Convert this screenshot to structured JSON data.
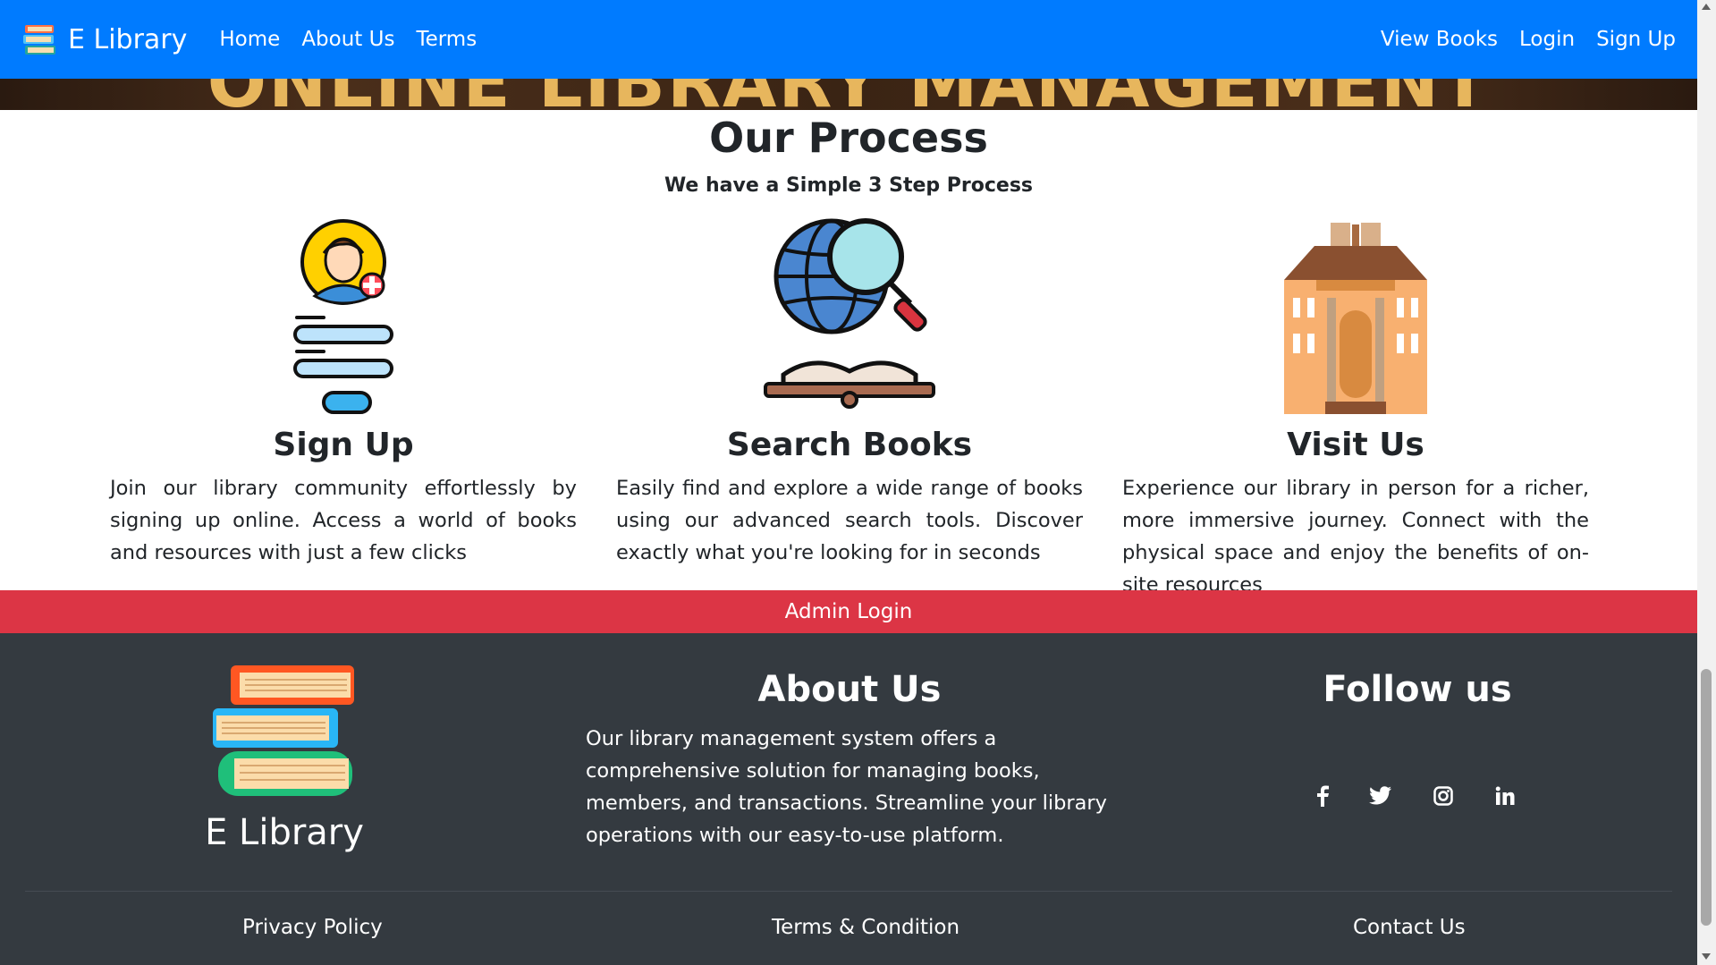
{
  "nav": {
    "brand": "E Library",
    "left_links": [
      "Home",
      "About Us",
      "Terms"
    ],
    "right_links": [
      "View Books",
      "Login",
      "Sign Up"
    ]
  },
  "banner": {
    "text": "ONLINE LIBRARY MANAGEMENT"
  },
  "process": {
    "title": "Our Process",
    "subtitle": "We have a Simple 3 Step Process",
    "steps": [
      {
        "title": "Sign Up",
        "icon": "user-signup-icon",
        "description": "Join our library community effortlessly by signing up online. Access a world of books and resources with just a few clicks"
      },
      {
        "title": "Search Books",
        "icon": "globe-search-book-icon",
        "description": "Easily find and explore a wide range of books using our advanced search tools. Discover exactly what you're looking for in seconds"
      },
      {
        "title": "Visit Us",
        "icon": "library-building-icon",
        "description": "Experience our library in person for a richer, more immersive journey. Connect with the physical space and enjoy the benefits of on-site resources"
      }
    ]
  },
  "admin": {
    "label": "Admin Login"
  },
  "footer": {
    "brand": "E Library",
    "about_title": "About Us",
    "about_text": "Our library management system offers a comprehensive solution for managing books, members, and transactions. Streamline your library operations with our easy-to-use platform.",
    "follow_title": "Follow us",
    "social_icons": [
      "facebook-icon",
      "twitter-icon",
      "instagram-icon",
      "linkedin-icon"
    ],
    "links": [
      "Privacy Policy",
      "Terms & Condition",
      "Contact Us"
    ]
  },
  "colors": {
    "navbar": "#007bff",
    "admin_bar": "#dc3545",
    "footer": "#343a40"
  }
}
